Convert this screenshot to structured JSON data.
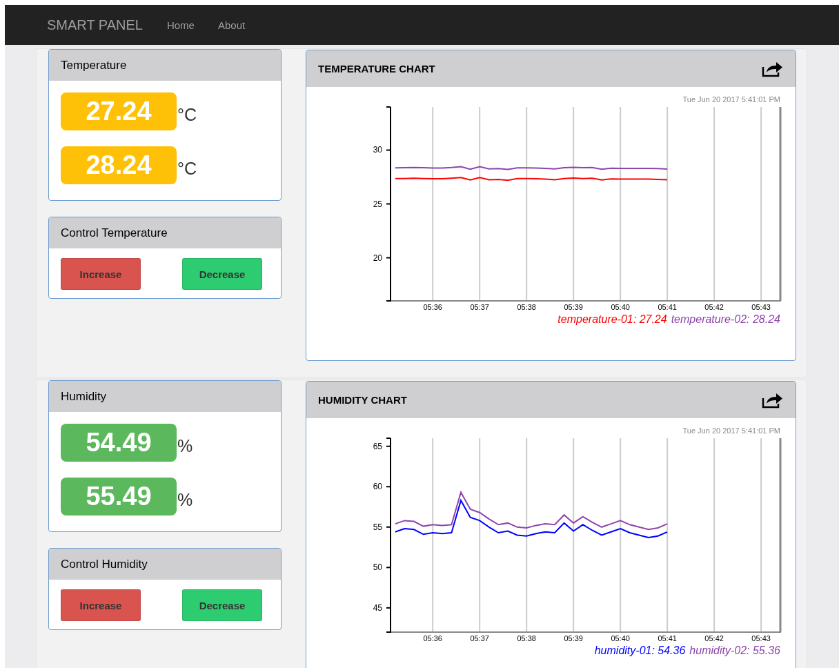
{
  "navbar": {
    "brand": "SMART PANEL",
    "links": [
      {
        "label": "Home"
      },
      {
        "label": "About"
      }
    ]
  },
  "sections": [
    {
      "readings": {
        "title": "Temperature",
        "color": "#ffc107",
        "values": [
          {
            "value": "27.24",
            "unit": "°C"
          },
          {
            "value": "28.24",
            "unit": "°C"
          }
        ]
      },
      "control": {
        "title": "Control Temperature",
        "buttons": [
          {
            "label": "Increase",
            "kind": "increase"
          },
          {
            "label": "Decrease",
            "kind": "decrease"
          }
        ]
      },
      "chart": {
        "title": "TEMPERATURE CHART",
        "timestamp": "Tue Jun 20 2017 5:41:01 PM",
        "chart_data": {
          "type": "line",
          "grid": true,
          "ylim": [
            16,
            34
          ],
          "yticks": [
            20,
            25,
            30
          ],
          "categories": [
            null,
            null,
            null,
            null,
            "05:36",
            null,
            null,
            null,
            null,
            "05:37",
            null,
            null,
            null,
            null,
            "05:38",
            null,
            null,
            null,
            null,
            "05:39",
            null,
            null,
            null,
            null,
            "05:40",
            null,
            null,
            null,
            null,
            "05:41",
            null,
            null,
            null,
            null,
            "05:42",
            null,
            null,
            null,
            null,
            "05:43",
            null,
            null
          ],
          "series": [
            {
              "name": "temperature-01: 27.24",
              "color": "#ff0000",
              "values": [
                27.35,
                27.36,
                27.38,
                27.36,
                27.33,
                27.34,
                27.38,
                27.45,
                27.22,
                27.45,
                27.25,
                27.28,
                27.2,
                27.35,
                27.35,
                27.33,
                27.3,
                27.25,
                27.36,
                27.4,
                27.36,
                27.38,
                27.22,
                27.32,
                27.3,
                27.3,
                27.3,
                27.3,
                27.28,
                27.24,
                null,
                null,
                null,
                null,
                null,
                null,
                null,
                null,
                null,
                null,
                null,
                null
              ]
            },
            {
              "name": "temperature-02: 28.24",
              "color": "#8e44ad",
              "values": [
                28.35,
                28.36,
                28.38,
                28.36,
                28.33,
                28.34,
                28.38,
                28.45,
                28.22,
                28.45,
                28.25,
                28.28,
                28.2,
                28.35,
                28.35,
                28.33,
                28.3,
                28.25,
                28.36,
                28.4,
                28.36,
                28.38,
                28.22,
                28.32,
                28.3,
                28.3,
                28.3,
                28.3,
                28.28,
                28.24,
                null,
                null,
                null,
                null,
                null,
                null,
                null,
                null,
                null,
                null,
                null,
                null
              ]
            }
          ]
        }
      }
    },
    {
      "readings": {
        "title": "Humidity",
        "color": "#5cb85c",
        "values": [
          {
            "value": "54.49",
            "unit": "%"
          },
          {
            "value": "55.49",
            "unit": "%"
          }
        ]
      },
      "control": {
        "title": "Control Humidity",
        "buttons": [
          {
            "label": "Increase",
            "kind": "increase"
          },
          {
            "label": "Decrease",
            "kind": "decrease"
          }
        ]
      },
      "chart": {
        "title": "HUMIDITY CHART",
        "timestamp": "Tue Jun 20 2017 5:41:01 PM",
        "chart_data": {
          "type": "line",
          "grid": true,
          "ylim": [
            42,
            66
          ],
          "yticks": [
            45,
            50,
            55,
            60,
            65
          ],
          "categories": [
            null,
            null,
            null,
            null,
            "05:36",
            null,
            null,
            null,
            null,
            "05:37",
            null,
            null,
            null,
            null,
            "05:38",
            null,
            null,
            null,
            null,
            "05:39",
            null,
            null,
            null,
            null,
            "05:40",
            null,
            null,
            null,
            null,
            "05:41",
            null,
            null,
            null,
            null,
            "05:42",
            null,
            null,
            null,
            null,
            "05:43",
            null,
            null
          ],
          "series": [
            {
              "name": "humidity-01: 54.36",
              "color": "#0000ff",
              "values": [
                54.4,
                54.8,
                54.7,
                54.1,
                54.3,
                54.2,
                54.3,
                58.3,
                56.2,
                55.8,
                55.0,
                54.3,
                54.5,
                54.0,
                53.9,
                54.2,
                54.4,
                54.3,
                55.5,
                54.5,
                55.3,
                54.6,
                54.0,
                54.4,
                54.8,
                54.3,
                54.0,
                53.7,
                53.9,
                54.4,
                null,
                null,
                null,
                null,
                null,
                null,
                null,
                null,
                null,
                null,
                null,
                null
              ]
            },
            {
              "name": "humidity-02: 55.36",
              "color": "#8e44ad",
              "values": [
                55.4,
                55.8,
                55.7,
                55.1,
                55.3,
                55.2,
                55.3,
                59.3,
                57.2,
                56.8,
                56.0,
                55.3,
                55.5,
                55.0,
                54.9,
                55.2,
                55.4,
                55.3,
                56.5,
                55.5,
                56.3,
                55.6,
                55.0,
                55.4,
                55.8,
                55.3,
                55.0,
                54.7,
                54.9,
                55.4,
                null,
                null,
                null,
                null,
                null,
                null,
                null,
                null,
                null,
                null,
                null,
                null
              ]
            }
          ]
        }
      }
    }
  ]
}
